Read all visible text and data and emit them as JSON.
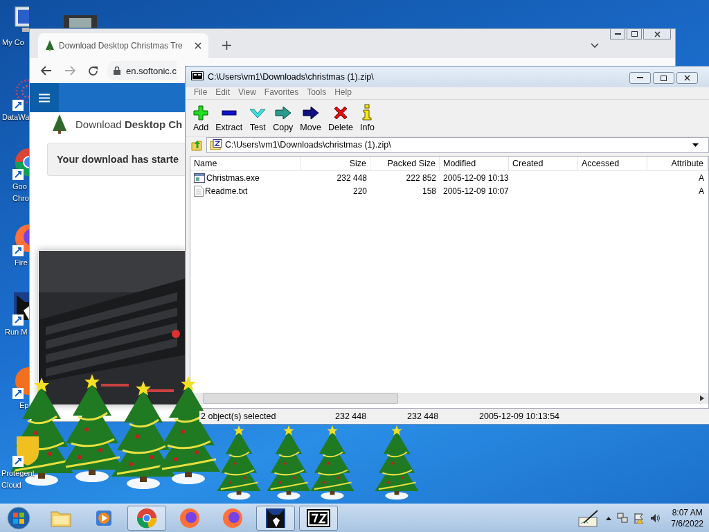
{
  "desktop": {
    "icons": [
      {
        "kind": "computer",
        "lines": [
          "My Co"
        ]
      },
      {
        "kind": "film"
      },
      {
        "kind": "dots",
        "lines": [
          "DataWa"
        ]
      },
      {
        "kind": "chrome",
        "lines": [
          "Goo",
          "Chro"
        ]
      },
      {
        "kind": "firefox",
        "lines": [
          "Fire"
        ]
      },
      {
        "kind": "cat",
        "lines": [
          "Run M"
        ]
      },
      {
        "kind": "epic",
        "lines": [
          "Ep"
        ]
      },
      {
        "kind": "shield",
        "lines": [
          "Protegent",
          "Cloud"
        ]
      }
    ]
  },
  "browser": {
    "tab": {
      "title": "Download Desktop Christmas Tre"
    },
    "url": "en.softonic.c",
    "page": {
      "heading": "Download **Desktop Ch**",
      "notice": "Your download has starte"
    }
  },
  "archiver": {
    "title": "C:\\Users\\vm1\\Downloads\\christmas (1).zip\\",
    "menu": [
      "File",
      "Edit",
      "View",
      "Favorites",
      "Tools",
      "Help"
    ],
    "toolbar": [
      {
        "kind": "add",
        "label": "Add"
      },
      {
        "kind": "extract",
        "label": "Extract"
      },
      {
        "kind": "test",
        "label": "Test"
      },
      {
        "kind": "copy",
        "label": "Copy"
      },
      {
        "kind": "move",
        "label": "Move"
      },
      {
        "kind": "delete",
        "label": "Delete"
      },
      {
        "kind": "info",
        "label": "Info"
      }
    ],
    "address": "C:\\Users\\vm1\\Downloads\\christmas (1).zip\\",
    "columns": [
      {
        "label": "Name"
      },
      {
        "label": "Size"
      },
      {
        "label": "Packed Size"
      },
      {
        "label": "Modified"
      },
      {
        "label": "Created"
      },
      {
        "label": "Accessed"
      },
      {
        "label": "Attribute"
      }
    ],
    "rows": [
      {
        "kind": "exe",
        "cells": [
          "Christmas.exe",
          "232 448",
          "222 852",
          "2005-12-09 10:13",
          "",
          "",
          "A"
        ]
      },
      {
        "kind": "txt",
        "cells": [
          "Readme.txt",
          "220",
          "158",
          "2005-12-09 10:07",
          "",
          "",
          "A"
        ]
      }
    ],
    "status": [
      "2 object(s) selected",
      "232 448",
      "232 448",
      "2005-12-09 10:13:54"
    ]
  },
  "taskbar": {
    "items": [
      {
        "kind": "folder",
        "running": false
      },
      {
        "kind": "media",
        "running": false
      },
      {
        "kind": "chrome",
        "running": true
      },
      {
        "kind": "firefox",
        "running": false
      },
      {
        "kind": "firefox",
        "running": false
      },
      {
        "kind": "cat",
        "running": true
      },
      {
        "kind": "sevenzip",
        "running": true
      }
    ],
    "time": "8:07 AM",
    "date": "7/6/2022"
  }
}
